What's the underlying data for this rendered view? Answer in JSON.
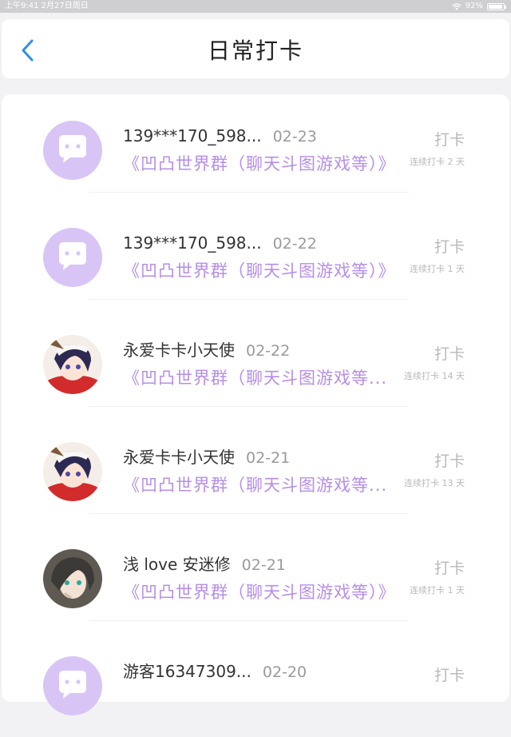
{
  "status_bar": {
    "time_date": "上午9:41   2月27日周日",
    "battery": "92%",
    "battery_level": 0.92
  },
  "header": {
    "title": "日常打卡",
    "back_icon": "chevron-left-icon"
  },
  "colors": {
    "accent_blue": "#2f8fe8",
    "group_purple": "#b68ee8",
    "avatar_bg": "#d8c5f5"
  },
  "records": [
    {
      "user": "139***170_598...",
      "date": "02-23",
      "group": "《凹凸世界群（聊天斗图游戏等）》",
      "action": "打卡",
      "streak": "连续打卡 2 天",
      "avatar": "default-chat-avatar"
    },
    {
      "user": "139***170_598...",
      "date": "02-22",
      "group": "《凹凸世界群（聊天斗图游戏等）》",
      "action": "打卡",
      "streak": "连续打卡 1 天",
      "avatar": "default-chat-avatar"
    },
    {
      "user": "永爱卡卡小天使",
      "date": "02-22",
      "group": "《凹凸世界群（聊天斗图游戏等...",
      "action": "打卡",
      "streak": "连续打卡 14 天",
      "avatar": "anime-avatar-red"
    },
    {
      "user": "永爱卡卡小天使",
      "date": "02-21",
      "group": "《凹凸世界群（聊天斗图游戏等...",
      "action": "打卡",
      "streak": "连续打卡 13 天",
      "avatar": "anime-avatar-red"
    },
    {
      "user": "浅 love 安迷修",
      "date": "02-21",
      "group": "《凹凸世界群（聊天斗图游戏等）》",
      "action": "打卡",
      "streak": "连续打卡 1 天",
      "avatar": "anime-avatar-dark"
    },
    {
      "user": "游客16347309...",
      "date": "02-20",
      "group": "",
      "action": "打卡",
      "streak": "",
      "avatar": "default-chat-avatar"
    }
  ]
}
